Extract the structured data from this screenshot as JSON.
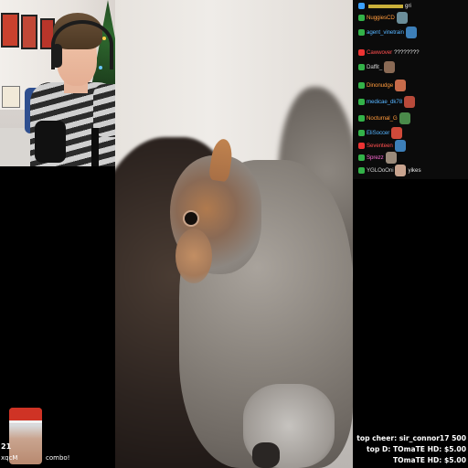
{
  "chat": {
    "lines": [
      {
        "name": "",
        "name_color": "#7ad3ff",
        "badge_color": "#3aa0ff",
        "message": "gri",
        "emote_color": ""
      },
      {
        "name": "NuggiesCD",
        "name_color": "#ff9a3c",
        "badge_color": "#33b249",
        "message": "",
        "emote_color": "#6b8e9a"
      },
      {
        "name": "agent_vinetrain",
        "name_color": "#56b4ff",
        "badge_color": "#33b249",
        "message": "",
        "emote_color": "#3d7fb8"
      },
      {
        "name": "Cawwover",
        "name_color": "#ff4f4f",
        "badge_color": "#e33",
        "message": "????????",
        "emote_color": ""
      },
      {
        "name": "Daffit_",
        "name_color": "#cfcfcf",
        "badge_color": "#33b249",
        "message": "",
        "emote_color": "#8a6a55"
      },
      {
        "name": "Dinonudge",
        "name_color": "#ff9a3c",
        "badge_color": "#33b249",
        "message": "",
        "emote_color": "#c76b4a"
      },
      {
        "name": "medicae_dk78",
        "name_color": "#56b4ff",
        "badge_color": "#33b249",
        "message": "",
        "emote_color": "#b84a3a"
      },
      {
        "name": "Nocturnal_G",
        "name_color": "#ff9a3c",
        "badge_color": "#33b249",
        "message": "",
        "emote_color": "#4a8a4a"
      },
      {
        "name": "EliSoccer",
        "name_color": "#56b4ff",
        "badge_color": "#33b249",
        "message": "",
        "emote_color": "#d04a3a"
      },
      {
        "name": "Seventeen",
        "name_color": "#ff4f4f",
        "badge_color": "#e33",
        "message": "",
        "emote_color": "#3d7fb8"
      },
      {
        "name": "Sprezz",
        "name_color": "#ff6bd6",
        "badge_color": "#33b249",
        "message": "",
        "emote_color": "#9a8a7a"
      },
      {
        "name": "YGLOoOni",
        "name_color": "#cfcfcf",
        "badge_color": "#33b249",
        "message": "yikes",
        "emote_color": "#c9a48f"
      }
    ]
  },
  "alert": {
    "count": "21",
    "user": "xqcM",
    "combo_label": "combo!"
  },
  "tops": {
    "cheer": "top cheer: sir_connor17 500",
    "donation_day": "top D: TOmaTE HD: $5.00",
    "donation_all": "TOmaTE HD: $5.00"
  }
}
